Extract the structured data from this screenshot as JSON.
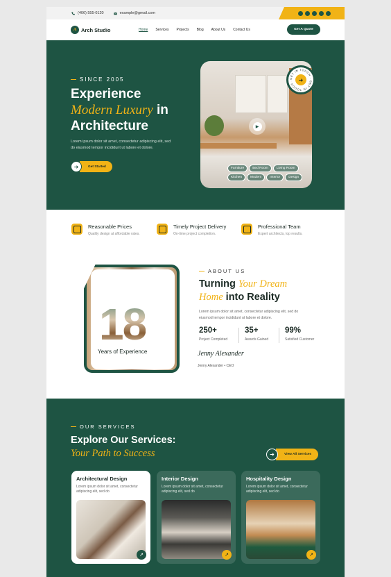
{
  "topbar": {
    "phone": "(406) 555-0120",
    "email": "example@gmail.com",
    "social": [
      "facebook-icon",
      "twitter-icon",
      "instagram-icon",
      "pinterest-icon",
      "youtube-icon"
    ]
  },
  "nav": {
    "brand": "Arch Studio",
    "logo_letter": "A",
    "items": [
      "Home",
      "Services",
      "Projects",
      "Blog",
      "About Us",
      "Contact Us"
    ],
    "active": "Home",
    "cta": "Get A Quote"
  },
  "hero": {
    "since": "SINCE 2005",
    "title_line1": "Experience",
    "title_italic": "Modern Luxury",
    "title_in": " in",
    "title_line3": "Architecture",
    "paragraph": "Lorem ipsum dolor sit amet, consectetur adipiscing elit, sed do eiusmod tempor incididunt ut labore et dolore.",
    "button": "Get Started",
    "badge_text": "GET IN TOUCH · GET IN TOUCH ·",
    "tags": [
      "Furniture",
      "Bed Room",
      "Living Room",
      "Kitchen",
      "Modern",
      "Interior",
      "Design"
    ]
  },
  "features": [
    {
      "title": "Reasonable Prices",
      "sub": "Quality design at affordable rates."
    },
    {
      "title": "Timely Project Delivery",
      "sub": "On-time project completion."
    },
    {
      "title": "Professional Team",
      "sub": "Expert architects, top results."
    }
  ],
  "about": {
    "big_number": "18",
    "years_label": "Years of Experience",
    "label": "ABOUT US",
    "title_a": "Turning ",
    "title_italic1": "Your Dream",
    "title_italic2": "Home",
    "title_b": " into Reality",
    "paragraph": "Lorem ipsum dolor sit amet, consectetur adipiscing elit, sed do eiusmod tempor incididunt ut labore et dolore.",
    "stats": [
      {
        "value": "250+",
        "label": "Project Completed"
      },
      {
        "value": "35+",
        "label": "Awards Gained"
      },
      {
        "value": "99%",
        "label": "Satisfied Customer"
      }
    ],
    "signature": "Jenny Alexander",
    "ceo": "Jenny Alexander • CEO"
  },
  "services": {
    "label": "OUR SERVICES",
    "title": "Explore Our Services:",
    "title_italic": "Your Path to Success",
    "button": "View All Services",
    "cards": [
      {
        "title": "Architectural Design",
        "desc": "Lorem ipsum dolor sit amet, consectetur adipiscing elit, sed do"
      },
      {
        "title": "Interior Design",
        "desc": "Lorem ipsum dolor sit amet, consectetur adipiscing elit, sed do"
      },
      {
        "title": "Hospitality Design",
        "desc": "Lorem ipsum dolor sit amet, consectetur adipiscing elit, sed do"
      }
    ]
  },
  "colors": {
    "primary": "#1e5443",
    "accent": "#f1b316"
  }
}
